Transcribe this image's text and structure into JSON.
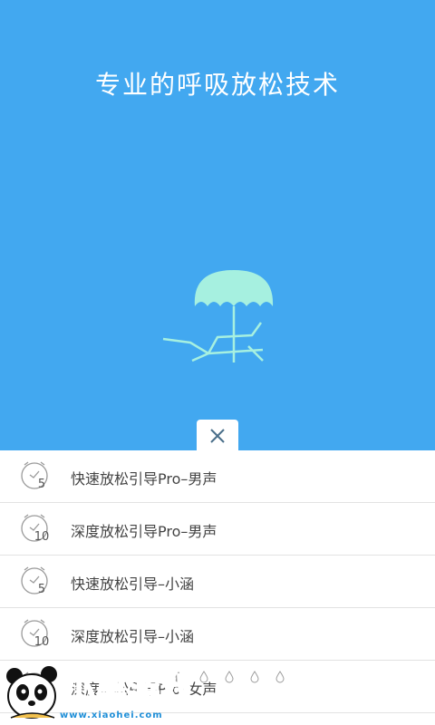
{
  "hero": {
    "title": "专业的呼吸放松技术",
    "background": "#42a8f0",
    "illustration_icon": "beach-umbrella-lounge-chair-icon"
  },
  "close_button": {
    "icon": "close-icon"
  },
  "list": {
    "items": [
      {
        "label": "快速放松引导Pro–男声",
        "duration": "5",
        "icon": "clock-icon"
      },
      {
        "label": "深度放松引导Pro–男声",
        "duration": "10",
        "icon": "clock-icon"
      },
      {
        "label": "快速放松引导–小涵",
        "duration": "5",
        "icon": "clock-icon"
      },
      {
        "label": "深度放松引导–小涵",
        "duration": "10",
        "icon": "clock-icon"
      },
      {
        "label": "深度放松引导Pro–女声",
        "duration": "",
        "icon": "clock-icon"
      }
    ]
  },
  "pager": {
    "count": 5,
    "active_index": 0
  },
  "watermark": {
    "brand": "小黑游戏",
    "url": "www.xiaohei.com"
  },
  "colors": {
    "accent": "#42a8f0",
    "umbrella": "#a6f0e0",
    "divider": "#e2e2e2"
  }
}
